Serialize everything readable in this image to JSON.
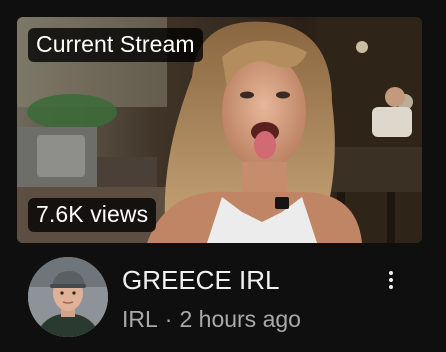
{
  "video": {
    "live_label": "Current Stream",
    "views_label": "7.6K views",
    "title": "GREECE IRL",
    "channel": "IRL",
    "separator": "·",
    "time_ago": "2 hours ago"
  },
  "icons": {
    "more": "more-vertical-icon",
    "avatar": "channel-avatar"
  },
  "colors": {
    "background": "#0f0f0f",
    "title_text": "#f1f1f1",
    "secondary_text": "#aaaaaa",
    "badge_bg": "#000000"
  }
}
